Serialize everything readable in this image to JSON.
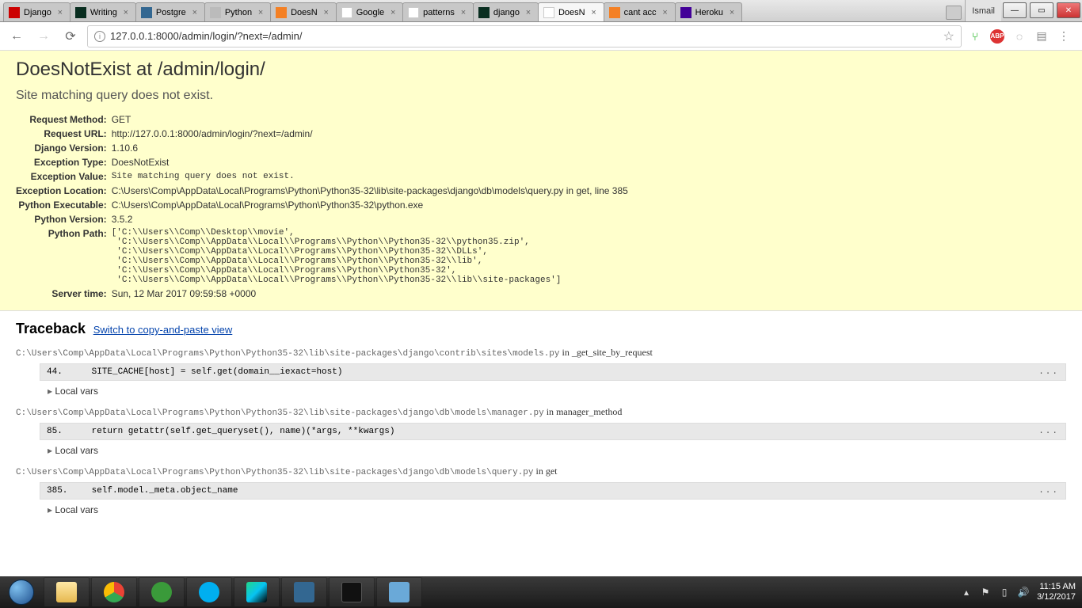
{
  "window": {
    "user_label": "Ismail",
    "tabs": [
      {
        "title": "Django",
        "fav": "fav-red"
      },
      {
        "title": "Writing",
        "fav": "fav-dark"
      },
      {
        "title": "Postgre",
        "fav": "fav-blue"
      },
      {
        "title": "Python",
        "fav": "fav-grey"
      },
      {
        "title": "DoesN",
        "fav": "fav-orange"
      },
      {
        "title": "Google",
        "fav": "fav-google"
      },
      {
        "title": "patterns",
        "fav": "fav-google"
      },
      {
        "title": "django",
        "fav": "fav-dark"
      },
      {
        "title": "DoesN",
        "fav": "fav-doc",
        "active": true
      },
      {
        "title": "cant acc",
        "fav": "fav-orange"
      },
      {
        "title": "Heroku",
        "fav": "fav-purple"
      }
    ]
  },
  "toolbar": {
    "url": "127.0.0.1:8000/admin/login/?next=/admin/"
  },
  "error": {
    "heading": "DoesNotExist at /admin/login/",
    "subhead": "Site matching query does not exist.",
    "rows": {
      "request_method_label": "Request Method:",
      "request_method": "GET",
      "request_url_label": "Request URL:",
      "request_url": "http://127.0.0.1:8000/admin/login/?next=/admin/",
      "django_version_label": "Django Version:",
      "django_version": "1.10.6",
      "exception_type_label": "Exception Type:",
      "exception_type": "DoesNotExist",
      "exception_value_label": "Exception Value:",
      "exception_value": "Site matching query does not exist.",
      "exception_location_label": "Exception Location:",
      "exception_location": "C:\\Users\\Comp\\AppData\\Local\\Programs\\Python\\Python35-32\\lib\\site-packages\\django\\db\\models\\query.py in get, line 385",
      "python_exe_label": "Python Executable:",
      "python_exe": "C:\\Users\\Comp\\AppData\\Local\\Programs\\Python\\Python35-32\\python.exe",
      "python_version_label": "Python Version:",
      "python_version": "3.5.2",
      "python_path_label": "Python Path:",
      "python_path": "['C:\\\\Users\\\\Comp\\\\Desktop\\\\movie',\n 'C:\\\\Users\\\\Comp\\\\AppData\\\\Local\\\\Programs\\\\Python\\\\Python35-32\\\\python35.zip',\n 'C:\\\\Users\\\\Comp\\\\AppData\\\\Local\\\\Programs\\\\Python\\\\Python35-32\\\\DLLs',\n 'C:\\\\Users\\\\Comp\\\\AppData\\\\Local\\\\Programs\\\\Python\\\\Python35-32\\\\lib',\n 'C:\\\\Users\\\\Comp\\\\AppData\\\\Local\\\\Programs\\\\Python\\\\Python35-32',\n 'C:\\\\Users\\\\Comp\\\\AppData\\\\Local\\\\Programs\\\\Python\\\\Python35-32\\\\lib\\\\site-packages']",
      "server_time_label": "Server time:",
      "server_time": "Sun, 12 Mar 2017 09:59:58 +0000"
    }
  },
  "traceback": {
    "heading": "Traceback",
    "switch_link": "Switch to copy-and-paste view",
    "frames": [
      {
        "path": "C:\\Users\\Comp\\AppData\\Local\\Programs\\Python\\Python35-32\\lib\\site-packages\\django\\contrib\\sites\\models.py",
        "in": " in ",
        "func": "_get_site_by_request",
        "lineno": "44.",
        "code": "            SITE_CACHE[host] = self.get(domain__iexact=host)",
        "local_vars": "Local vars"
      },
      {
        "path": "C:\\Users\\Comp\\AppData\\Local\\Programs\\Python\\Python35-32\\lib\\site-packages\\django\\db\\models\\manager.py",
        "in": " in ",
        "func": "manager_method",
        "lineno": "85.",
        "code": "            return getattr(self.get_queryset(), name)(*args, **kwargs)",
        "local_vars": "Local vars"
      },
      {
        "path": "C:\\Users\\Comp\\AppData\\Local\\Programs\\Python\\Python35-32\\lib\\site-packages\\django\\db\\models\\query.py",
        "in": " in ",
        "func": "get",
        "lineno": "385.",
        "code": "            self.model._meta.object_name",
        "local_vars": "Local vars"
      }
    ]
  },
  "ext_icons": {
    "abp": "ABP"
  },
  "tray": {
    "time": "11:15 AM",
    "date": "3/12/2017"
  }
}
